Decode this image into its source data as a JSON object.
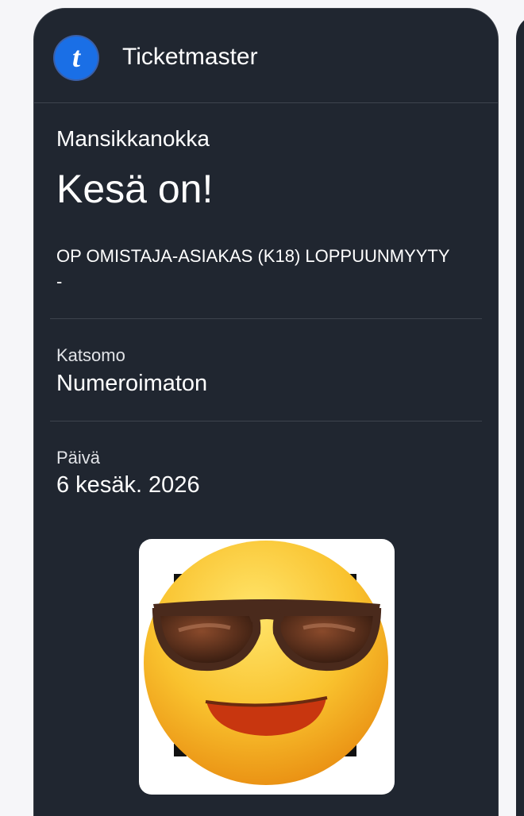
{
  "header": {
    "logo_letter": "t",
    "brand_name": "Ticketmaster"
  },
  "event": {
    "venue": "Mansikkanokka",
    "title": "Kesä on!",
    "ticket_type_line1": "OP OMISTAJA-ASIAKAS (K18) LOPPUUNMYYTY",
    "ticket_type_line2": "-"
  },
  "fields": {
    "section_label": "Katsomo",
    "section_value": "Numeroimaton",
    "date_label": "Päivä",
    "date_value": "6 kesäk. 2026"
  },
  "icons": {
    "logo": "ticketmaster-logo-icon",
    "code_overlay": "smiling-face-with-sunglasses-icon"
  },
  "colors": {
    "card_background": "#202630",
    "logo_blue": "#1a6fe6",
    "emoji_yellow": "#f7c12d"
  }
}
